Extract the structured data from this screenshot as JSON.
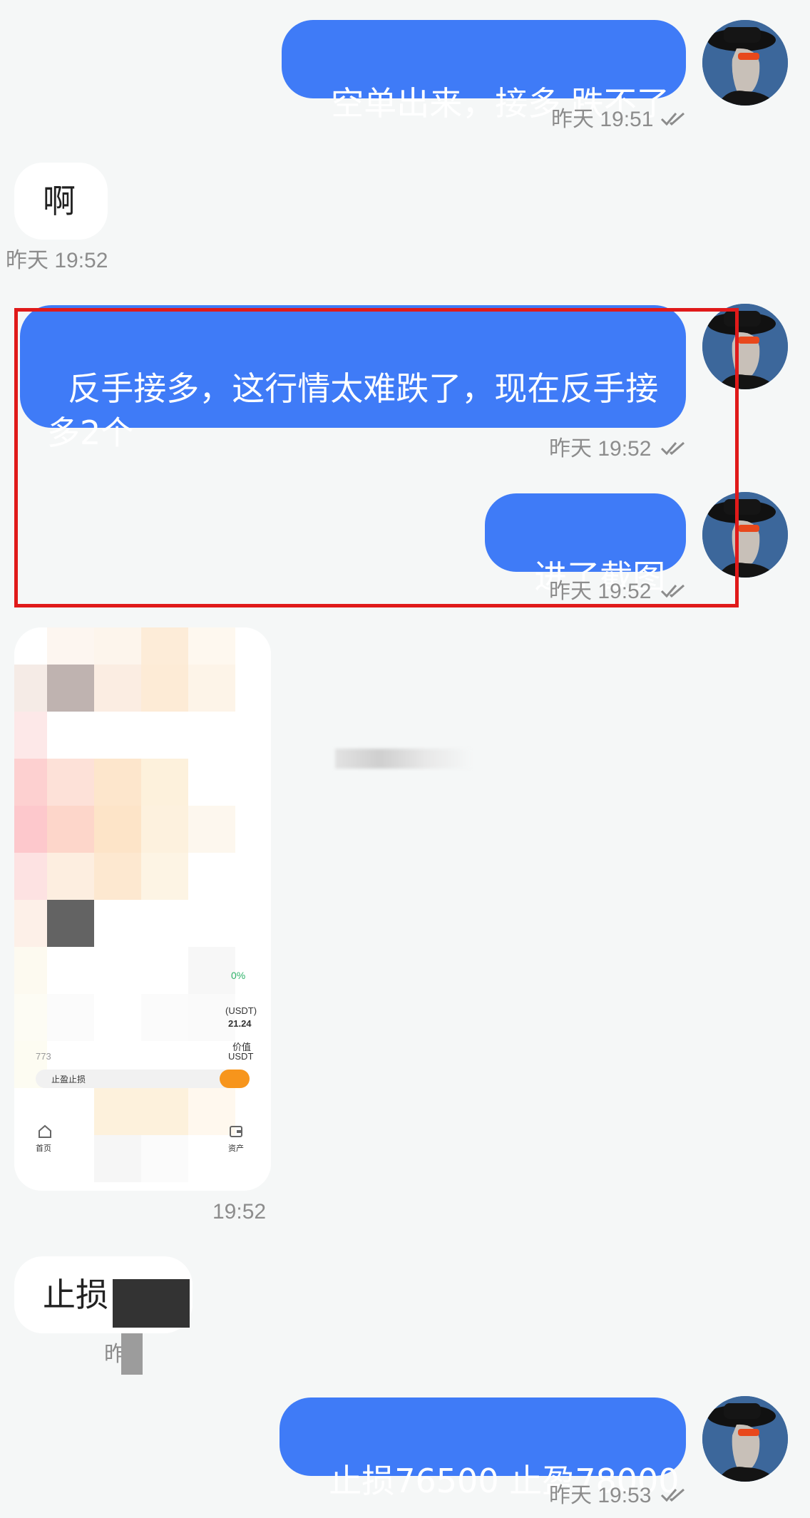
{
  "messages": {
    "m1": {
      "text": "空单出来，接多 跌不了",
      "time": "昨天 19:51"
    },
    "m2": {
      "text": "啊",
      "time": "昨天 19:52"
    },
    "m3": {
      "text": "反手接多，这行情太难跌了，现在反手接多2个",
      "time": "昨天 19:52"
    },
    "m4": {
      "text": "进了截图",
      "time": "昨天 19:52"
    },
    "m5": {
      "time": "19:52"
    },
    "m6": {
      "text": "止损",
      "time": "昨"
    },
    "m7": {
      "text": "止损76500 止盈78000",
      "time": "昨天 19:53"
    }
  },
  "screenshot": {
    "labels": {
      "stop": "止盈止损",
      "home": "首页",
      "assets": "资产",
      "usdt1": "(USDT)",
      "value1": "21.24",
      "value_label": "价值",
      "usdt2": "USDT",
      "percent": "0%",
      "num": "773"
    }
  },
  "colors": {
    "outgoing_bubble": "#3f7bf7",
    "incoming_bubble": "#ffffff",
    "highlight_box": "#e01a1a",
    "background": "#f5f7f7"
  },
  "icons": [
    "avatar",
    "double-check-icon",
    "home-icon",
    "wallet-icon"
  ]
}
